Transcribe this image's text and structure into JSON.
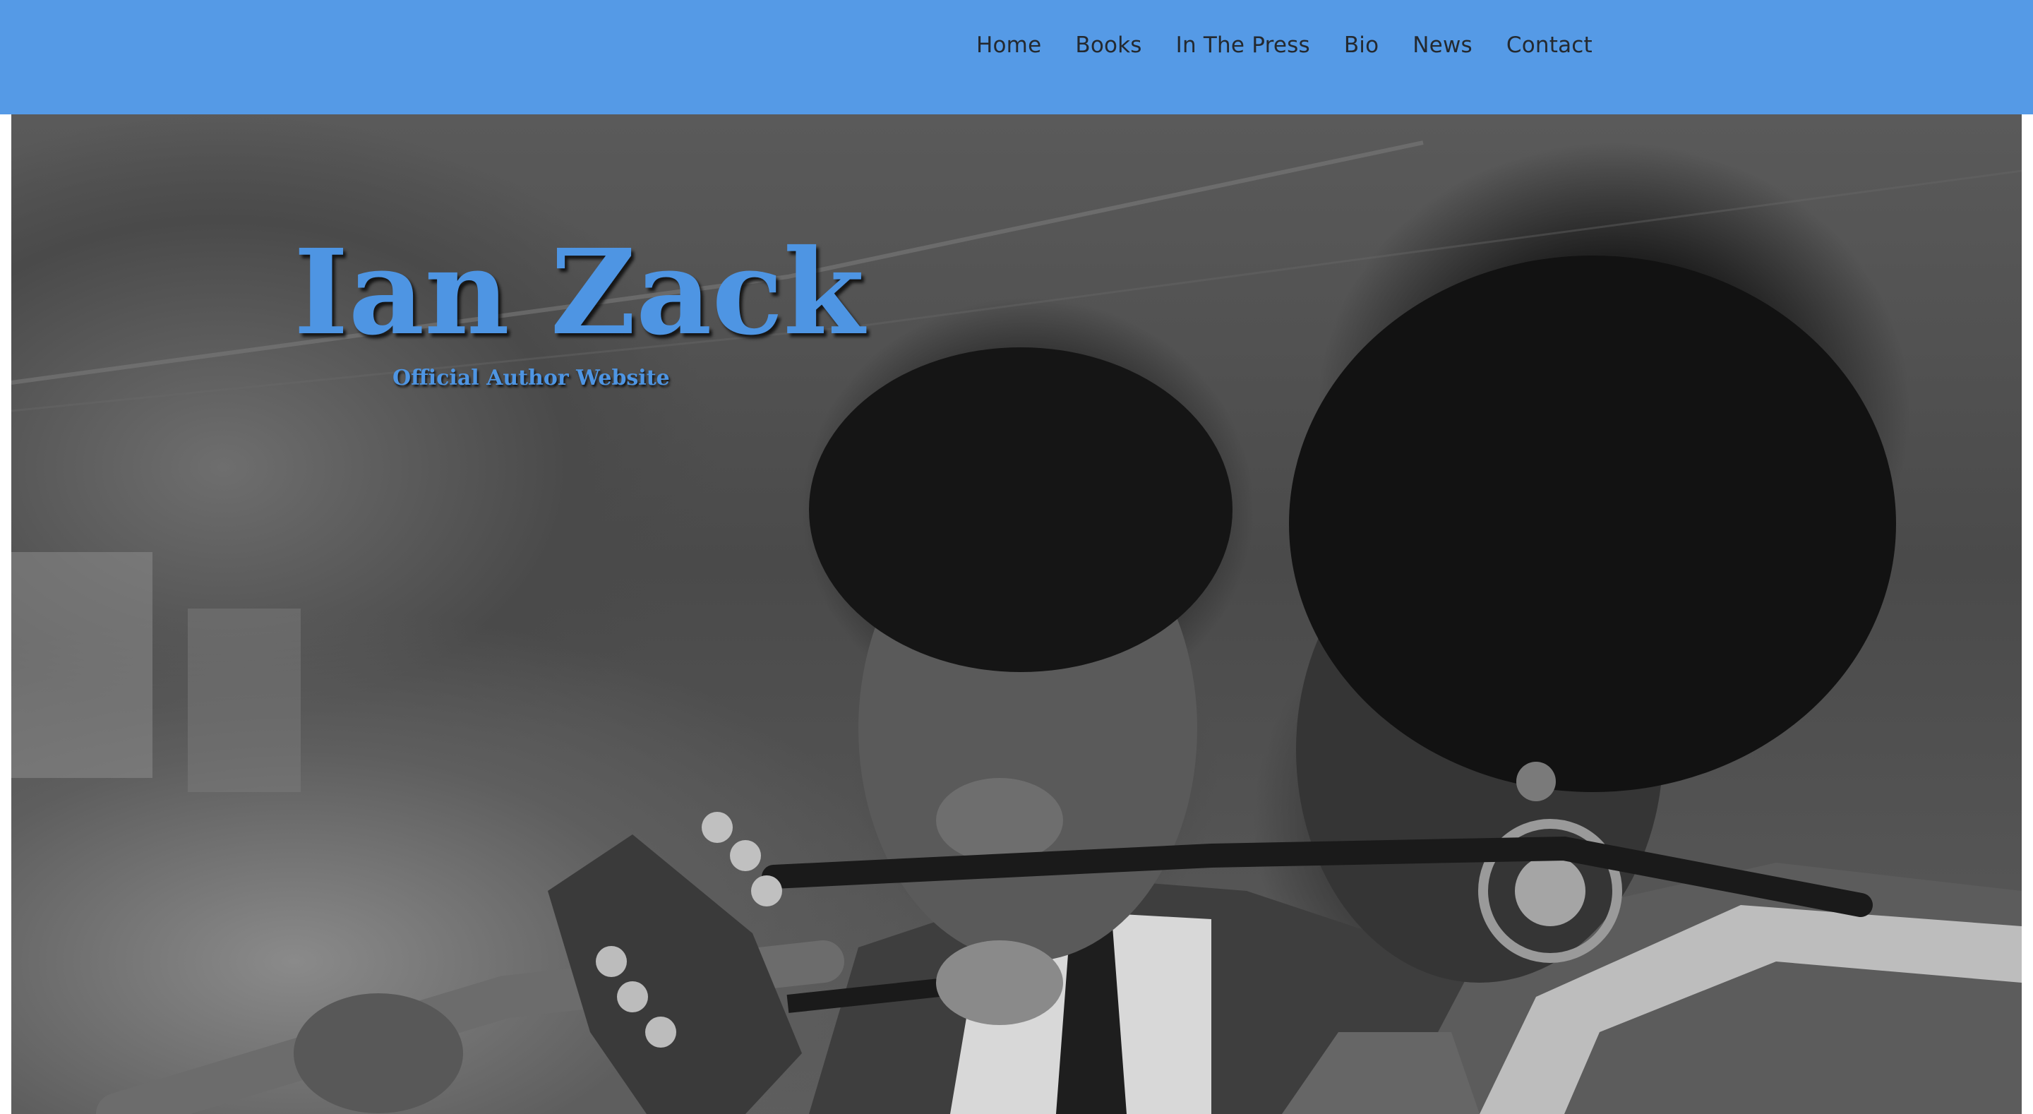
{
  "nav": {
    "items": [
      {
        "label": "Home"
      },
      {
        "label": "Books"
      },
      {
        "label": "In The Press"
      },
      {
        "label": "Bio"
      },
      {
        "label": "News"
      },
      {
        "label": "Contact"
      }
    ]
  },
  "hero": {
    "title": "Ian Zack",
    "subtitle": "Official Author Website",
    "image_description_icon": "photo-musicians-guitar"
  },
  "colors": {
    "header_bg": "#559ae6",
    "title_color": "#4e95e3",
    "nav_text": "#24292f"
  }
}
